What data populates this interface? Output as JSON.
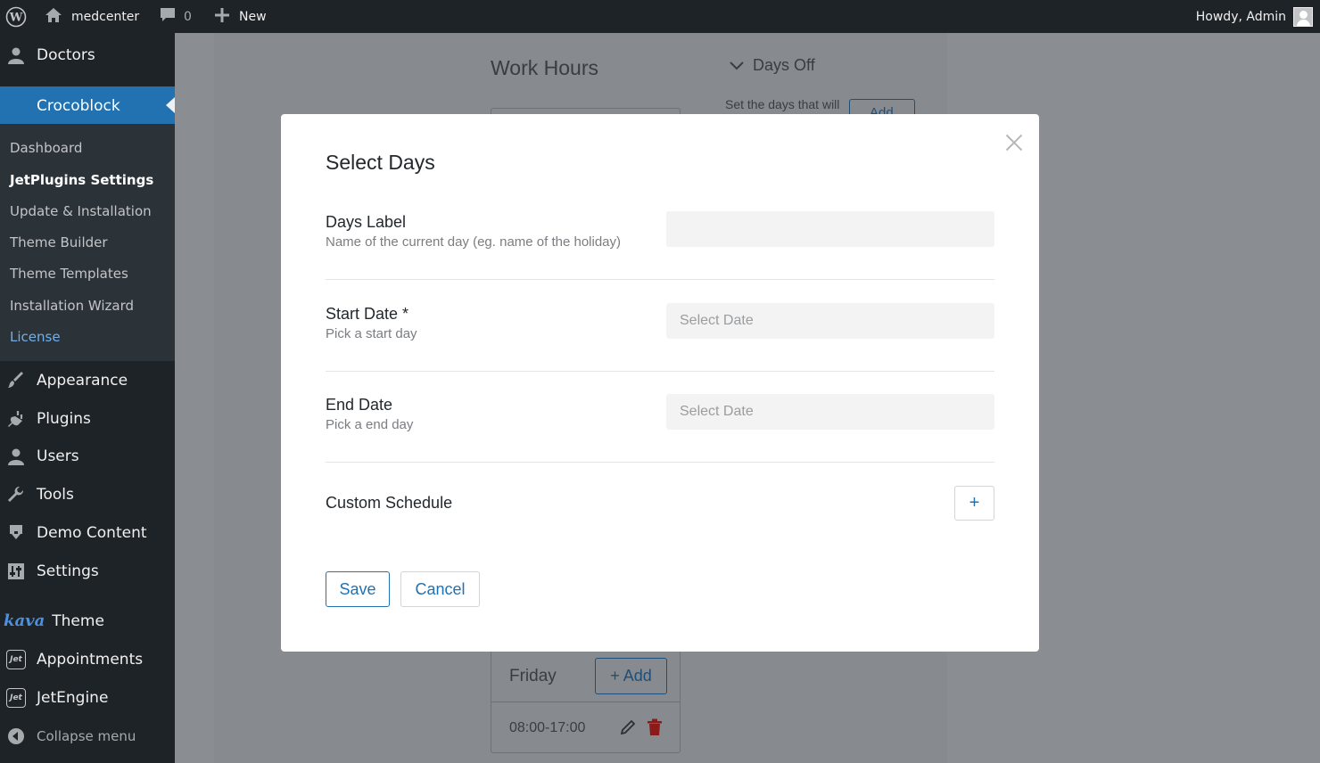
{
  "admin_bar": {
    "site_name": "medcenter",
    "comments_count": "0",
    "new_label": "New",
    "howdy": "Howdy, Admin"
  },
  "sidebar": {
    "doctors": "Doctors",
    "crocoblock": "Crocoblock",
    "submenu": [
      {
        "label": "Dashboard"
      },
      {
        "label": "JetPlugins Settings"
      },
      {
        "label": "Update & Installation"
      },
      {
        "label": "Theme Builder"
      },
      {
        "label": "Theme Templates"
      },
      {
        "label": "Installation Wizard"
      },
      {
        "label": "License"
      }
    ],
    "appearance": "Appearance",
    "plugins": "Plugins",
    "users": "Users",
    "tools": "Tools",
    "demo_content": "Demo Content",
    "settings": "Settings",
    "kava_logo": "kava",
    "theme": "Theme",
    "jet_badge": "Jet",
    "appointments": "Appointments",
    "jetengine": "JetEngine",
    "collapse": "Collapse menu"
  },
  "background": {
    "work_hours": "Work Hours",
    "days_off": "Days Off",
    "days_off_desc": "Set the days that will",
    "add_top": "Add",
    "friday": "Friday",
    "add_btn": "+ Add",
    "time_range": "08:00-17:00"
  },
  "modal": {
    "title": "Select Days",
    "days_label": {
      "label": "Days Label",
      "desc": "Name of the current day (eg. name of the holiday)",
      "value": ""
    },
    "start_date": {
      "label": "Start Date *",
      "desc": "Pick a start day",
      "placeholder": "Select Date"
    },
    "end_date": {
      "label": "End Date",
      "desc": "Pick a end day",
      "placeholder": "Select Date"
    },
    "custom_schedule": {
      "label": "Custom Schedule",
      "button": "+"
    },
    "save": "Save",
    "cancel": "Cancel"
  },
  "colors": {
    "accent": "#2271b1",
    "admin_bar": "#1d2327",
    "overlay": "#8a8d91"
  }
}
